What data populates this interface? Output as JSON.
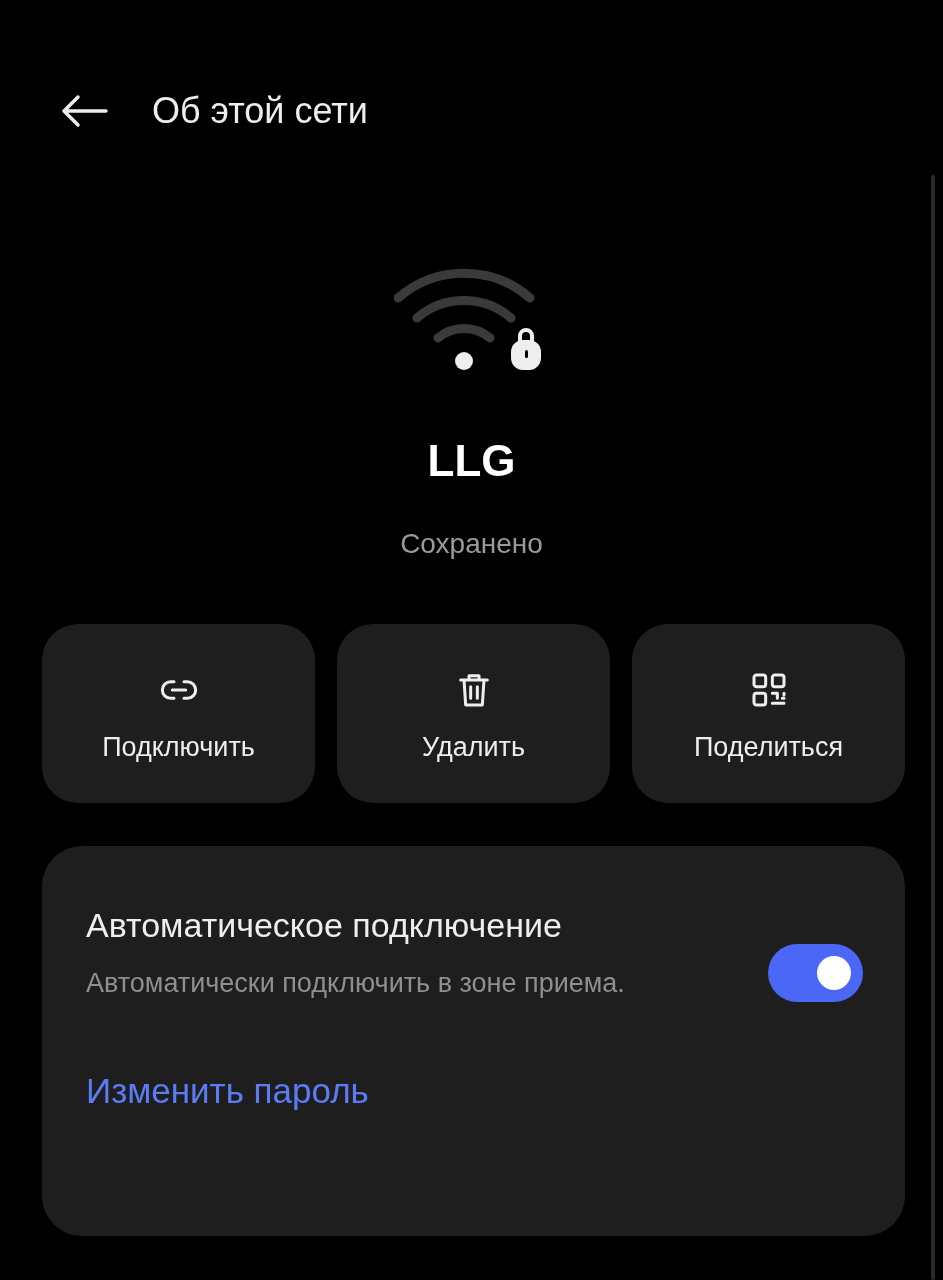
{
  "header": {
    "title": "Об этой сети"
  },
  "network": {
    "name": "LLG",
    "status": "Сохранено",
    "secured": true
  },
  "actions": [
    {
      "kind": "connect",
      "label": "Подключить"
    },
    {
      "kind": "delete",
      "label": "Удалить"
    },
    {
      "kind": "share",
      "label": "Поделиться"
    }
  ],
  "auto_connect": {
    "title": "Автоматическое подключение",
    "description": "Автоматически подключить в зоне приема.",
    "on": true
  },
  "change_password": {
    "label": "Изменить пароль"
  }
}
